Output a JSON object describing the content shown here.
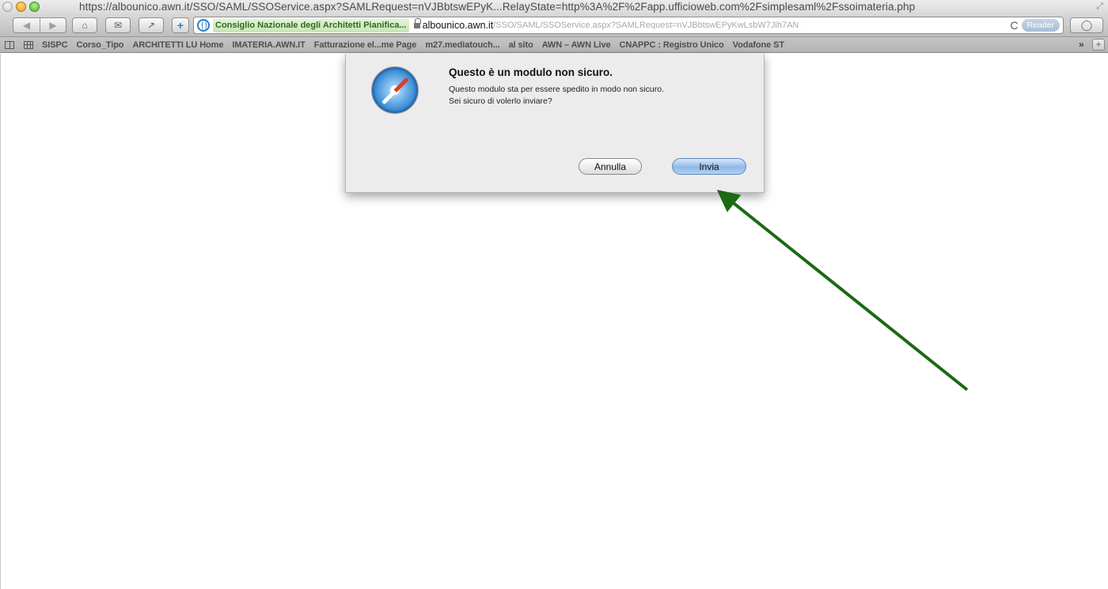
{
  "window": {
    "title": "https://albounico.awn.it/SSO/SAML/SSOService.aspx?SAMLRequest=nVJBbtswEPyK...RelayState=http%3A%2F%2Fapp.ufficioweb.com%2Fsimplesaml%2Fssoimateria.php"
  },
  "toolbar": {
    "plus_label": "+",
    "ev_badge": "Consiglio Nazionale degli Architetti Pianifica...",
    "url_host": "albounico.awn.it",
    "url_path": "/SSO/SAML/SSOService.aspx?SAMLRequest=nVJBbtswEPyKwLsbW7Jih7AN",
    "reader_label": "Reader",
    "reload_glyph": "C"
  },
  "bookmarks": {
    "items": [
      "SISPC",
      "Corso_Tipo",
      "ARCHITETTI LU Home",
      "IMATERIA.AWN.IT",
      "Fatturazione el...me Page",
      "m27.mediatouch...",
      "al sito",
      "AWN – AWN Live",
      "CNAPPC : Registro Unico",
      "Vodafone ST"
    ],
    "more_label": "»",
    "add_label": "+"
  },
  "dialog": {
    "title": "Questo è un modulo non sicuro.",
    "message": "Questo modulo sta per essere spedito in modo non sicuro.\nSei sicuro di volerlo inviare?",
    "cancel_label": "Annulla",
    "submit_label": "Invia"
  },
  "annotation": {
    "arrow_color": "#1a6b12",
    "target": "Invia"
  }
}
